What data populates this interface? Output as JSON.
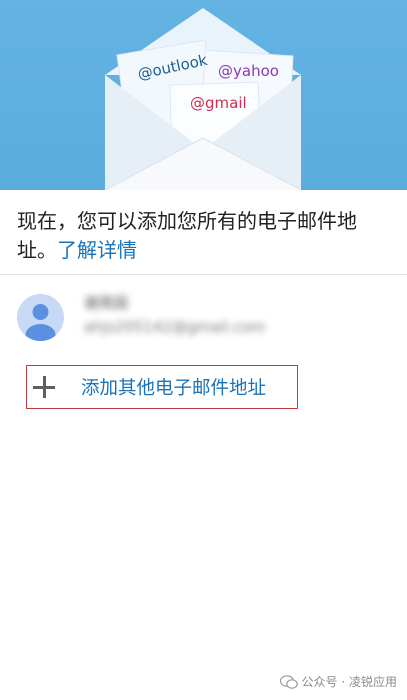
{
  "banner": {
    "cards": {
      "outlook": "@outlook",
      "yahoo": "@yahoo",
      "gmail": "@gmail"
    },
    "background_color": "#63b3e3"
  },
  "intro": {
    "text": "现在，您可以添加您所有的电子邮件地址。",
    "learn_more": "了解详情"
  },
  "account": {
    "name": "谢雨辰",
    "email": "ahjs205142@gmail.com",
    "avatar_icon": "person-icon"
  },
  "add_account": {
    "label": "添加其他电子邮件地址",
    "icon": "plus-icon",
    "highlight_color": "#c0393b"
  },
  "watermark": {
    "text": "公众号 · 凌锐应用"
  }
}
